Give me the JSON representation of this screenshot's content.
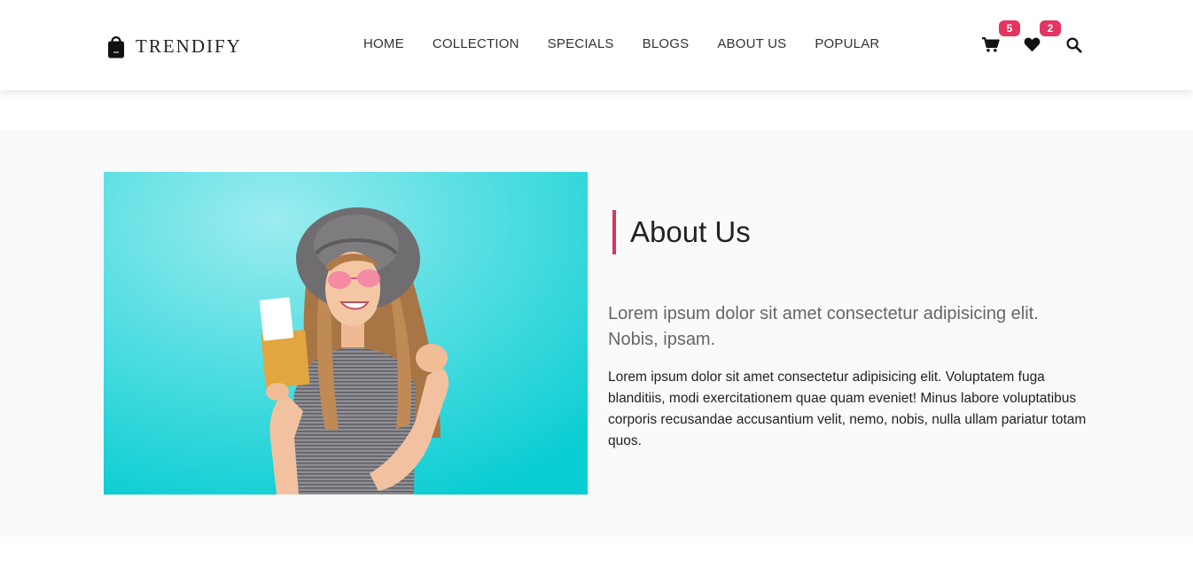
{
  "brand": {
    "name": "TRENDIFY",
    "icon": "shopping-bag-icon"
  },
  "nav": {
    "links": [
      "HOME",
      "COLLECTION",
      "SPECIALS",
      "BLOGS",
      "ABOUT US",
      "POPULAR"
    ]
  },
  "header_icons": {
    "cart": {
      "icon": "cart-icon",
      "badge": "5"
    },
    "wishlist": {
      "icon": "heart-icon",
      "badge": "2"
    },
    "search": {
      "icon": "search-icon"
    }
  },
  "about": {
    "title": "About Us",
    "lead": "Lorem ipsum dolor sit amet consectetur adipisicing elit. Nobis, ipsam.",
    "body": "Lorem ipsum dolor sit amet consectetur adipisicing elit. Voluptatem fuga blanditiis, modi exercitationem quae quam eveniet! Minus labore voluptatibus corporis recusandae accusantium velit, nemo, nobis, nulla ullam pariatur totam quos."
  },
  "colors": {
    "accent": "#e2355f",
    "title_bar": "#d9365c",
    "section_bg": "#fafafa",
    "photo_bg": "#10cfd3"
  }
}
